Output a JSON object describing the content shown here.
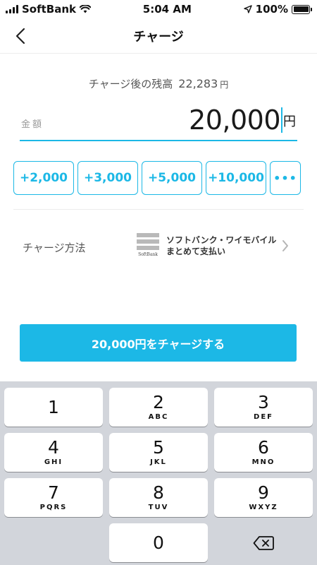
{
  "status_bar": {
    "carrier": "SoftBank",
    "time": "5:04 AM",
    "battery": "100%"
  },
  "nav": {
    "title": "チャージ"
  },
  "balance": {
    "label": "チャージ後の残高",
    "value": "22,283",
    "unit": "円"
  },
  "amount_field": {
    "label": "金額",
    "value": "20,000",
    "unit": "円"
  },
  "quick_amounts": [
    "+2,000",
    "+3,000",
    "+5,000",
    "+10,000",
    "•••"
  ],
  "method": {
    "label": "チャージ方法",
    "logo_text": "SoftBank",
    "line1": "ソフトバンク・ワイモバイル",
    "line2": "まとめて支払い"
  },
  "charge_button": {
    "label": "20,000円をチャージする"
  },
  "keypad": {
    "keys": [
      {
        "num": "1",
        "letters": ""
      },
      {
        "num": "2",
        "letters": "ABC"
      },
      {
        "num": "3",
        "letters": "DEF"
      },
      {
        "num": "4",
        "letters": "GHI"
      },
      {
        "num": "5",
        "letters": "JKL"
      },
      {
        "num": "6",
        "letters": "MNO"
      },
      {
        "num": "7",
        "letters": "PQRS"
      },
      {
        "num": "8",
        "letters": "TUV"
      },
      {
        "num": "9",
        "letters": "WXYZ"
      },
      {
        "num": "0",
        "letters": ""
      }
    ]
  },
  "colors": {
    "accent": "#1cb8e6",
    "keypad_bg": "#d2d5db"
  },
  "icons": {
    "back": "chevron-left-icon",
    "chevron": "chevron-right-icon",
    "delete": "backspace-icon"
  }
}
